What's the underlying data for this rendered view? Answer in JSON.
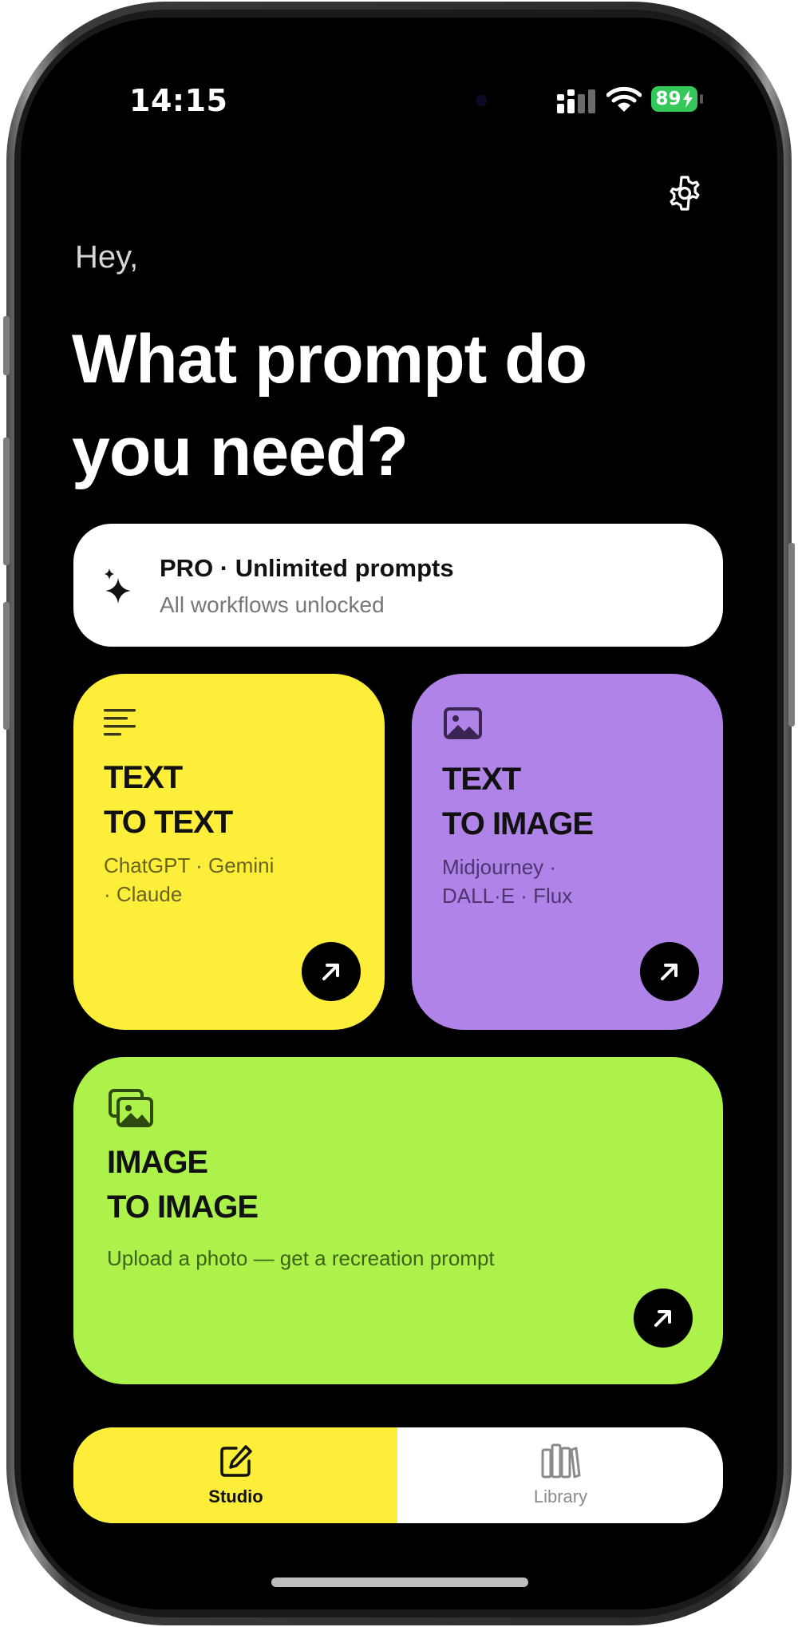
{
  "status": {
    "time": "14:15",
    "battery": "89"
  },
  "greeting": "Hey,",
  "headline_line1": "What prompt do",
  "headline_line2": "you need?",
  "pro_banner": {
    "title": "PRO · Unlimited prompts",
    "subtitle": "All workflows unlocked"
  },
  "cards": [
    {
      "title_line1": "TEXT",
      "title_line2": "TO TEXT",
      "sub_line1": "ChatGPT · Gemini",
      "sub_line2": "· Claude",
      "color": "#fdee3a",
      "icon": "text-lines-icon"
    },
    {
      "title_line1": "TEXT",
      "title_line2": "TO IMAGE",
      "sub_line1": "Midjourney ·",
      "sub_line2": "DALL·E · Flux",
      "color": "#b083e8",
      "icon": "image-icon"
    },
    {
      "title_line1": "IMAGE",
      "title_line2": "TO IMAGE",
      "sub_line1": "Upload a photo — get a recreation prompt",
      "color": "#adf24b",
      "icon": "images-stack-icon"
    }
  ],
  "tabs": [
    {
      "label": "Studio",
      "icon": "edit-icon",
      "active": true
    },
    {
      "label": "Library",
      "icon": "books-icon",
      "active": false
    }
  ],
  "colors": {
    "accent_yellow": "#fdee3a",
    "accent_purple": "#b083e8",
    "accent_green": "#adf24b",
    "battery_green": "#34c759"
  }
}
